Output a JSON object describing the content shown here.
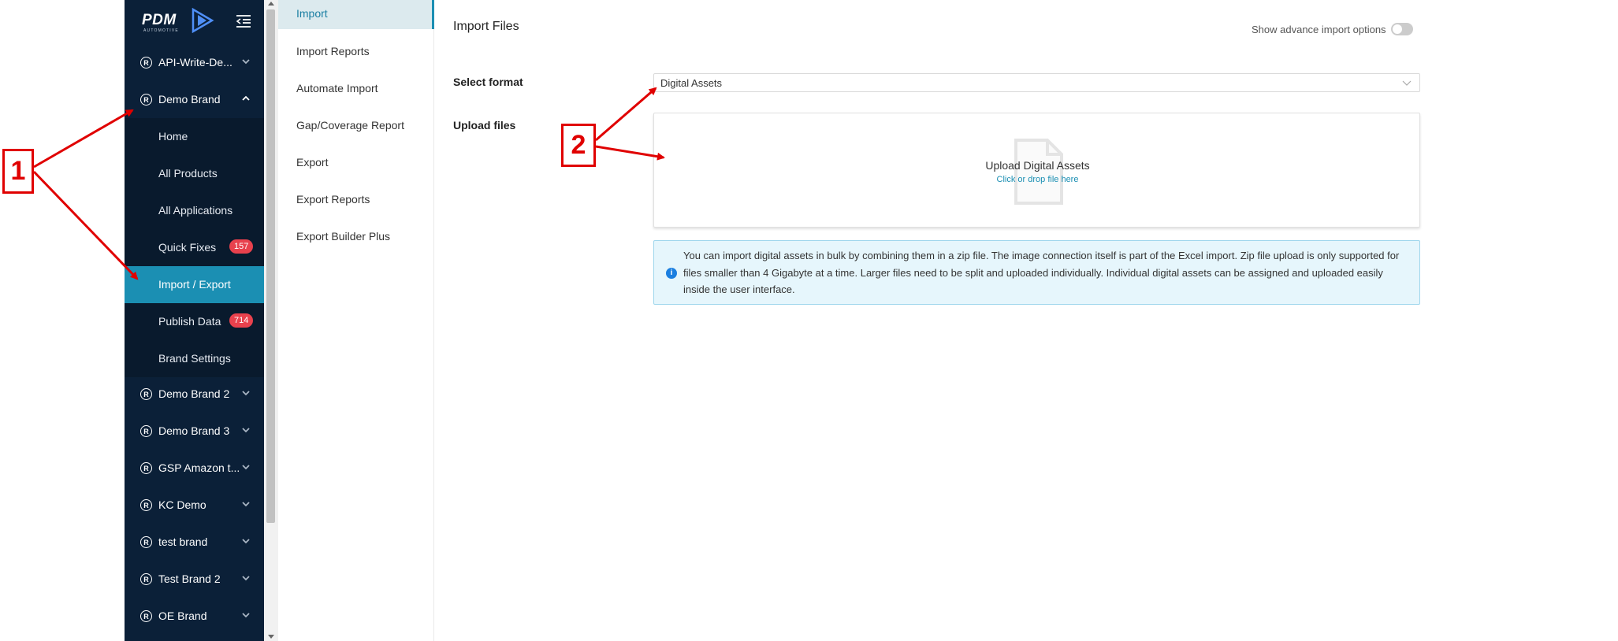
{
  "sidebar": {
    "logo": {
      "text": "PDM",
      "subtext": "AUTOMOTIVE"
    },
    "brands_top": [
      {
        "label": "API-Write-De...",
        "expanded": false
      },
      {
        "label": "Demo Brand",
        "expanded": true
      }
    ],
    "demo_brand_items": [
      {
        "label": "Home"
      },
      {
        "label": "All Products"
      },
      {
        "label": "All Applications"
      },
      {
        "label": "Quick Fixes",
        "badge": "157"
      },
      {
        "label": "Import / Export",
        "active": true
      },
      {
        "label": "Publish Data",
        "badge": "714"
      },
      {
        "label": "Brand Settings"
      }
    ],
    "brands_bottom": [
      {
        "label": "Demo Brand 2"
      },
      {
        "label": "Demo Brand 3"
      },
      {
        "label": "GSP Amazon t..."
      },
      {
        "label": "KC Demo"
      },
      {
        "label": "test brand"
      },
      {
        "label": "Test Brand 2"
      },
      {
        "label": "OE Brand"
      }
    ],
    "badge_color": "#e8414d",
    "active_color": "#1b8fb3"
  },
  "submenu": {
    "items": [
      {
        "label": "Import",
        "active": true
      },
      {
        "label": "Import Reports"
      },
      {
        "label": "Automate Import"
      },
      {
        "label": "Gap/Coverage Report"
      },
      {
        "label": "Export"
      },
      {
        "label": "Export Reports"
      },
      {
        "label": "Export Builder Plus"
      }
    ]
  },
  "main": {
    "title": "Import Files",
    "advanced_toggle_label": "Show advance import options",
    "advanced_toggle_on": false,
    "select_format_label": "Select format",
    "select_format_value": "Digital Assets",
    "upload_label": "Upload files",
    "upload_title": "Upload Digital Assets",
    "upload_hint": "Click or drop file here",
    "info_text": "You can import digital assets in bulk by combining them in a zip file. The image connection itself is part of the Excel import. Zip file upload is only supported for files smaller than 4 Gigabyte at a time. Larger files need to be split and uploaded individually. Individual digital assets can be assigned and uploaded easily inside the user interface."
  },
  "annotations": {
    "callout_1": "1",
    "callout_2": "2",
    "color": "#e00000"
  }
}
